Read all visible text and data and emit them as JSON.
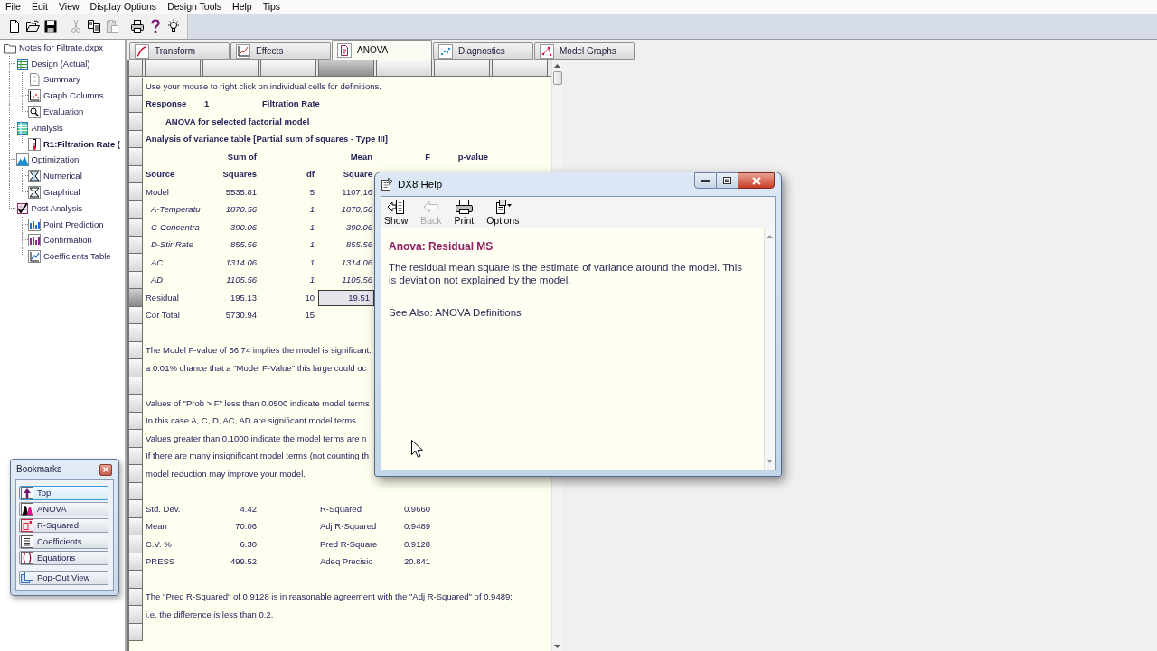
{
  "menu_bar": [
    "File",
    "Edit",
    "View",
    "Display Options",
    "Design Tools",
    "Help",
    "Tips"
  ],
  "toolbar": [
    {
      "buttons": [
        {
          "kind": "new",
          "disabled": false
        },
        {
          "kind": "open",
          "disabled": false
        },
        {
          "kind": "save",
          "disabled": false
        }
      ]
    },
    {
      "buttons": [
        {
          "kind": "cut",
          "disabled": true
        },
        {
          "kind": "copy",
          "disabled": false
        },
        {
          "kind": "paste",
          "disabled": true
        }
      ]
    },
    {
      "buttons": [
        {
          "kind": "print",
          "disabled": false
        },
        {
          "kind": "help",
          "disabled": false
        },
        {
          "kind": "tip",
          "disabled": false
        }
      ]
    }
  ],
  "tree": {
    "label": "Notes for Filtrate.dxpx",
    "kind": "folder",
    "selected": false,
    "children": [
      {
        "label": "Design (Actual)",
        "kind": "design",
        "selected": false,
        "children": [
          {
            "label": "Summary",
            "kind": "summary",
            "selected": false
          },
          {
            "label": "Graph Columns",
            "kind": "graph_columns",
            "selected": false
          },
          {
            "label": "Evaluation",
            "kind": "evaluation",
            "selected": false
          }
        ]
      },
      {
        "label": "Analysis",
        "kind": "analysis",
        "selected": false,
        "children": [
          {
            "label": "R1:Filtration Rate (",
            "kind": "response",
            "selected": true
          }
        ]
      },
      {
        "label": "Optimization",
        "kind": "optimization",
        "selected": false,
        "children": [
          {
            "label": "Numerical",
            "kind": "numerical",
            "selected": false
          },
          {
            "label": "Graphical",
            "kind": "graphical",
            "selected": false
          }
        ]
      },
      {
        "label": "Post Analysis",
        "kind": "post_analysis",
        "selected": false,
        "children": [
          {
            "label": "Point Prediction",
            "kind": "point_prediction",
            "selected": false
          },
          {
            "label": "Confirmation",
            "kind": "confirmation",
            "selected": false
          },
          {
            "label": "Coefficients Table",
            "kind": "coefficients_table",
            "selected": false
          }
        ]
      }
    ]
  },
  "tabs": [
    {
      "label": "Transform",
      "kind": "transform",
      "selected": false
    },
    {
      "label": "Effects",
      "kind": "effects",
      "selected": false
    },
    {
      "label": "ANOVA",
      "kind": "anova",
      "selected": true
    },
    {
      "label": "Diagnostics",
      "kind": "diagnostics",
      "selected": false
    },
    {
      "label": "Model Graphs",
      "kind": "model_graphs",
      "selected": false
    }
  ],
  "column_headers": [
    {
      "selected": false
    },
    {
      "selected": false
    },
    {
      "selected": false
    },
    {
      "selected": true
    },
    {
      "selected": false
    },
    {
      "selected": false
    },
    {
      "selected": false
    }
  ],
  "document": {
    "rows": [
      {
        "kind": "note",
        "text": "Use your mouse to right click on individual cells for definitions.",
        "selected": false
      },
      {
        "kind": "response",
        "column_1": "Response",
        "column_2": "1",
        "column_3": "Filtration Rate",
        "selected": false
      },
      {
        "kind": "title",
        "text": "ANOVA for selected factorial model",
        "selected": false
      },
      {
        "kind": "heading",
        "text": "Analysis of variance table [Partial sum of squares - Type III]",
        "selected": false
      },
      {
        "kind": "header",
        "column_2": "Sum of",
        "column_4": "Mean",
        "column_5": "F",
        "column_6": "p-value",
        "selected": false
      },
      {
        "kind": "header",
        "column_1": "Source",
        "column_2": "Squares",
        "column_3": "df",
        "column_4": "Square",
        "selected": false
      },
      {
        "kind": "source",
        "column_1": "Model",
        "column_2": "5535.81",
        "column_3": "5",
        "column_4": "1107.16",
        "selected": false
      },
      {
        "kind": "term",
        "column_1": "A-Temperatu",
        "column_2": "1870.56",
        "column_3": "1",
        "column_4": "1870.56",
        "selected": false
      },
      {
        "kind": "term",
        "column_1": "C-Concentra",
        "column_2": "390.06",
        "column_3": "1",
        "column_4": "390.06",
        "selected": false
      },
      {
        "kind": "term",
        "column_1": "D-Stir Rate",
        "column_2": "855.56",
        "column_3": "1",
        "column_4": "855.56",
        "selected": false
      },
      {
        "kind": "term",
        "column_1": "AC",
        "column_2": "1314.06",
        "column_3": "1",
        "column_4": "1314.06",
        "selected": false
      },
      {
        "kind": "term",
        "column_1": "AD",
        "column_2": "1105.56",
        "column_3": "1",
        "column_4": "1105.56",
        "selected": false
      },
      {
        "kind": "source",
        "column_1": "Residual",
        "column_2": "195.13",
        "column_3": "10",
        "column_4": "19.51",
        "selected": true
      },
      {
        "kind": "source",
        "column_1": "Cor Total",
        "column_2": "5730.94",
        "column_3": "15",
        "selected": false
      },
      {
        "kind": "blank",
        "selected": false
      },
      {
        "kind": "note",
        "text": "The Model F-value of 56.74 implies the model is significant.",
        "selected": false
      },
      {
        "kind": "note",
        "text": "a 0.01% chance that a \"Model F-Value\" this large could oc",
        "selected": false
      },
      {
        "kind": "blank",
        "selected": false
      },
      {
        "kind": "note",
        "text": "Values of \"Prob > F\" less than 0.0500 indicate model terms",
        "selected": false
      },
      {
        "kind": "note",
        "text": "In this case A, C, D, AC, AD are significant model terms.",
        "selected": false
      },
      {
        "kind": "note",
        "text": "Values greater than 0.1000 indicate the model terms are n",
        "selected": false
      },
      {
        "kind": "note",
        "text": "If there are many insignificant model terms (not counting th",
        "selected": false
      },
      {
        "kind": "note",
        "text": "model reduction may improve your model.",
        "selected": false
      },
      {
        "kind": "blank",
        "selected": false
      },
      {
        "kind": "fit",
        "column_1": "Std. Dev.",
        "column_2": "4.42",
        "column_4": "R-Squared",
        "column_5": "0.9660",
        "selected": false
      },
      {
        "kind": "fit",
        "column_1": "Mean",
        "column_2": "70.06",
        "column_4": "Adj R-Squared",
        "column_5": "0.9489",
        "selected": false
      },
      {
        "kind": "fit",
        "column_1": "C.V. %",
        "column_2": "6.30",
        "column_4": "Pred R-Square",
        "column_5": "0.9128",
        "selected": false
      },
      {
        "kind": "fit",
        "column_1": "PRESS",
        "column_2": "499.52",
        "column_4": "Adeq Precisio",
        "column_5": "20.841",
        "selected": false
      },
      {
        "kind": "blank",
        "selected": false
      },
      {
        "kind": "note",
        "text": "The \"Pred R-Squared\" of 0.9128 is in reasonable agreement with the \"Adj R-Squared\" of 0.9489;",
        "selected": false
      },
      {
        "kind": "note",
        "text": "i.e. the difference is less than 0.2.",
        "selected": false
      },
      {
        "kind": "blank",
        "selected": false
      }
    ]
  },
  "help_window": {
    "title": "DX8 Help",
    "toolbar": [
      {
        "kind": "show",
        "label": "Show",
        "disabled": false
      },
      {
        "kind": "back",
        "label": "Back",
        "disabled": true
      },
      {
        "kind": "print",
        "label": "Print",
        "disabled": false
      },
      {
        "kind": "options",
        "label": "Options",
        "disabled": false
      }
    ],
    "topic_title": "Anova: Residual MS",
    "body": "The residual mean square is the estimate of variance around the model. This is deviation not explained by the model.",
    "see_also": "See Also: ANOVA Definitions"
  },
  "bookmarks": {
    "title": "Bookmarks",
    "items": [
      {
        "kind": "top",
        "label": "Top",
        "selected": true
      },
      {
        "kind": "anova",
        "label": "ANOVA",
        "selected": false
      },
      {
        "kind": "r_squared",
        "label": "R-Squared",
        "selected": false
      },
      {
        "kind": "coefficients",
        "label": "Coefficients",
        "selected": false
      },
      {
        "kind": "equations",
        "label": "Equations",
        "selected": false
      }
    ],
    "pop_out": {
      "kind": "pop_out",
      "label": "Pop-Out View"
    }
  }
}
